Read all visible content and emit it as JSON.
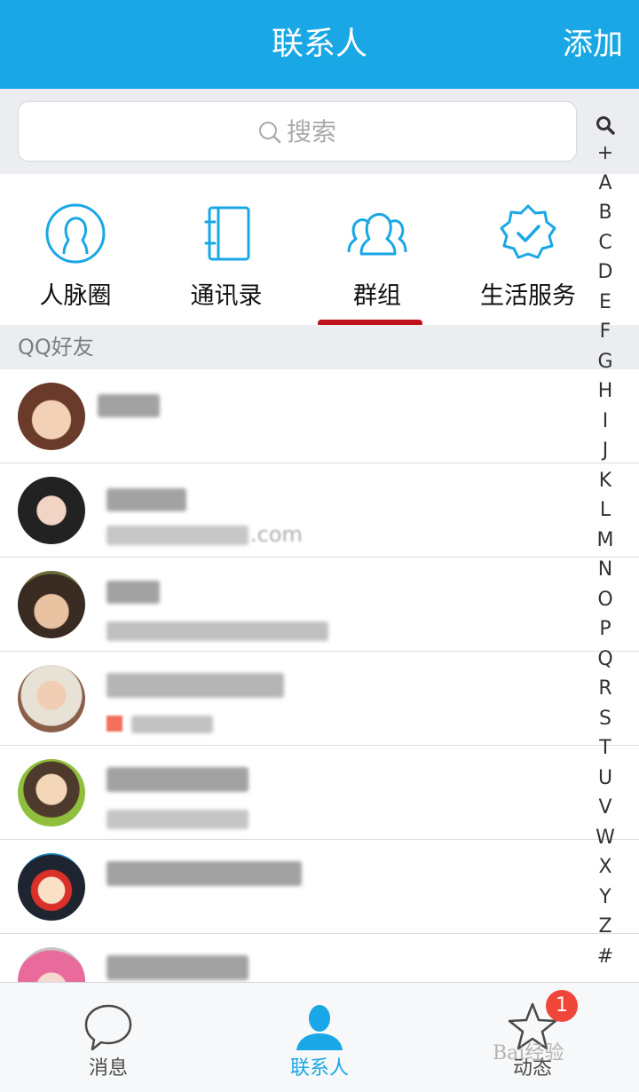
{
  "header": {
    "title": "联系人",
    "add_label": "添加"
  },
  "search": {
    "placeholder": "搜索"
  },
  "categories": [
    {
      "label": "人脉圈",
      "icon": "person-circle-icon"
    },
    {
      "label": "通讯录",
      "icon": "notebook-icon"
    },
    {
      "label": "群组",
      "icon": "group-icon",
      "selected": true
    },
    {
      "label": "生活服务",
      "icon": "verified-badge-icon"
    }
  ],
  "section": {
    "title": "QQ好友"
  },
  "contacts": [
    {
      "avatar": "avatar-1",
      "name": "",
      "subtitle": ""
    },
    {
      "avatar": "avatar-2",
      "name": "",
      "subtitle": ".com"
    },
    {
      "avatar": "avatar-3",
      "name": "",
      "subtitle": ""
    },
    {
      "avatar": "avatar-4",
      "name": "",
      "subtitle": ""
    },
    {
      "avatar": "avatar-5",
      "name": "",
      "subtitle": ""
    },
    {
      "avatar": "avatar-6",
      "name": "",
      "subtitle": ""
    },
    {
      "avatar": "avatar-7",
      "name": "",
      "subtitle": ""
    }
  ],
  "index_letters": [
    "+",
    "A",
    "B",
    "C",
    "D",
    "E",
    "F",
    "G",
    "H",
    "I",
    "J",
    "K",
    "L",
    "M",
    "N",
    "O",
    "P",
    "Q",
    "R",
    "S",
    "T",
    "U",
    "V",
    "W",
    "X",
    "Y",
    "Z",
    "#"
  ],
  "tabs": [
    {
      "label": "消息",
      "icon": "chat-bubble-icon"
    },
    {
      "label": "联系人",
      "icon": "person-icon",
      "active": true
    },
    {
      "label": "动态",
      "icon": "star-icon",
      "badge": "1"
    }
  ],
  "watermark": "Bai经验",
  "colors": {
    "accent": "#1aa7e6",
    "underline": "#c0121b",
    "badge": "#f0463a",
    "section_bg": "#ebedf0"
  }
}
